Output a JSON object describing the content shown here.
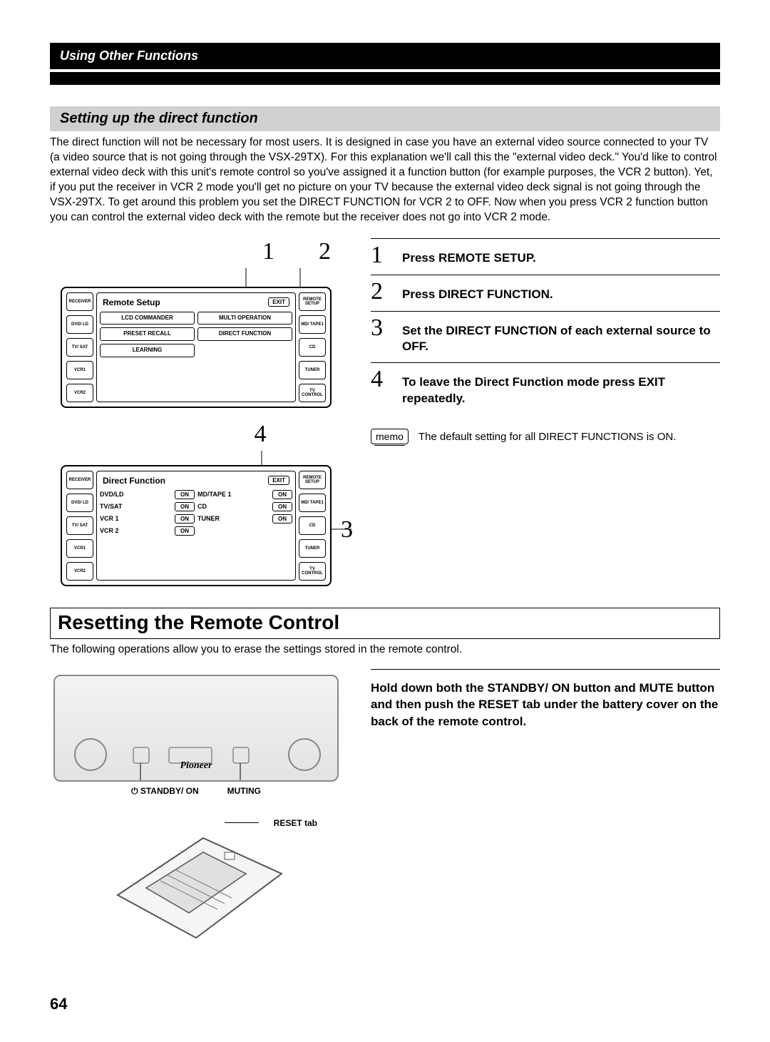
{
  "header": {
    "chapter": "Using Other Functions"
  },
  "section1": {
    "heading": "Setting up the direct function",
    "intro": "The direct function will not be necessary for most users. It is designed in case you have an external video source connected to your TV (a video source that is not going through the VSX-29TX). For this explanation we'll call this the \"external video deck.\" You'd like to control external video deck with this unit's remote control so you've assigned it a function button (for example purposes, the VCR 2 button). Yet, if you put the receiver in VCR 2 mode you'll get no picture on your TV because the external video deck signal is not going through the VSX-29TX. To get around this problem you set the DIRECT FUNCTION for VCR 2 to OFF. Now when you press VCR 2 function button you can control the external video deck with the remote but the receiver does not go into VCR 2 mode."
  },
  "callouts": {
    "c1": "1",
    "c2": "2",
    "c3": "3",
    "c4": "4"
  },
  "lcd1": {
    "title": "Remote Setup",
    "exit": "EXIT",
    "left": [
      "RECEIVER",
      "DVD/ LD",
      "TV/ SAT",
      "VCR1",
      "VCR2"
    ],
    "right": [
      "REMOTE SETUP",
      "MD/ TAPE1",
      "CD",
      "TUNER",
      "TV CONTROL"
    ],
    "cells": [
      "LCD COMMANDER",
      "MULTI OPERATION",
      "PRESET RECALL",
      "DIRECT FUNCTION",
      "LEARNING"
    ]
  },
  "lcd2": {
    "title": "Direct Function",
    "exit": "EXIT",
    "left": [
      "RECEIVER",
      "DVD/ LD",
      "TV/ SAT",
      "VCR1",
      "VCR2"
    ],
    "right": [
      "REMOTE SETUP",
      "MD/ TAPE1",
      "CD",
      "TUNER",
      "TV CONTROL"
    ],
    "rows": [
      {
        "a": "DVD/LD",
        "av": "ON",
        "b": "MD/TAPE 1",
        "bv": "ON"
      },
      {
        "a": "TV/SAT",
        "av": "ON",
        "b": "CD",
        "bv": "ON"
      },
      {
        "a": "VCR 1",
        "av": "ON",
        "b": "TUNER",
        "bv": "ON"
      },
      {
        "a": "VCR 2",
        "av": "ON",
        "b": "",
        "bv": ""
      }
    ]
  },
  "steps": {
    "s1": {
      "n": "1",
      "t": "Press REMOTE SETUP."
    },
    "s2": {
      "n": "2",
      "t": "Press DIRECT FUNCTION."
    },
    "s3": {
      "n": "3",
      "t": "Set the DIRECT FUNCTION of each external source to OFF."
    },
    "s4": {
      "n": "4",
      "t": "To leave the Direct Function mode press EXIT repeatedly."
    }
  },
  "memo": {
    "label": "memo",
    "text": "The default setting for all DIRECT FUNCTIONS is ON."
  },
  "section2": {
    "heading": "Resetting the Remote Control",
    "intro": "The following operations allow you to erase the settings stored in the remote control.",
    "brand": "Pioneer",
    "labels": {
      "standby": "STANDBY/ ON",
      "muting": "MUTING",
      "reset": "RESET tab"
    },
    "step": "Hold down both the STANDBY/ ON button and MUTE button and then push the RESET tab under the battery cover on the back of the remote control."
  },
  "pageNumber": "64"
}
